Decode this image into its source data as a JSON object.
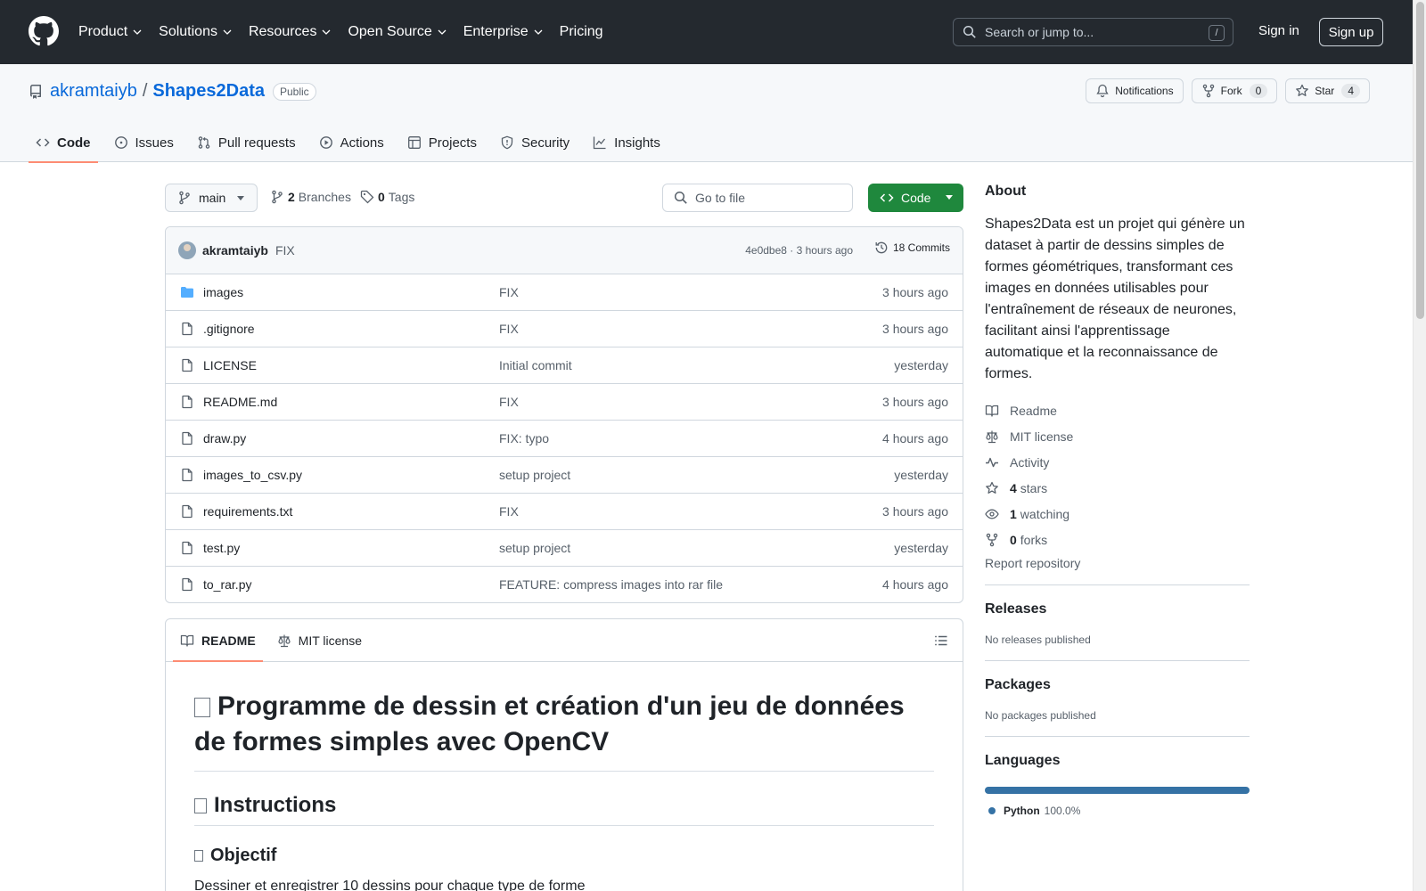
{
  "header": {
    "nav": [
      "Product",
      "Solutions",
      "Resources",
      "Open Source",
      "Enterprise",
      "Pricing"
    ],
    "search_placeholder": "Search or jump to...",
    "search_shortcut": "/",
    "sign_in": "Sign in",
    "sign_up": "Sign up"
  },
  "repo": {
    "owner": "akramtaiyb",
    "separator": "/",
    "name": "Shapes2Data",
    "visibility": "Public",
    "notifications_label": "Notifications",
    "fork_label": "Fork",
    "fork_count": "0",
    "star_label": "Star",
    "star_count": "4",
    "tabs": [
      "Code",
      "Issues",
      "Pull requests",
      "Actions",
      "Projects",
      "Security",
      "Insights"
    ]
  },
  "toolbar": {
    "branch": "main",
    "branches_count": "2",
    "branches_label": "Branches",
    "tags_count": "0",
    "tags_label": "Tags",
    "go_to_file": "Go to file",
    "code_button": "Code"
  },
  "latest_commit": {
    "author": "akramtaiyb",
    "message": "FIX",
    "sha_time": "4e0dbe8 · 3 hours ago",
    "commits_label": "18 Commits"
  },
  "files": [
    {
      "name": "images",
      "type": "folder",
      "message": "FIX",
      "time": "3 hours ago"
    },
    {
      "name": ".gitignore",
      "type": "file",
      "message": "FIX",
      "time": "3 hours ago"
    },
    {
      "name": "LICENSE",
      "type": "file",
      "message": "Initial commit",
      "time": "yesterday"
    },
    {
      "name": "README.md",
      "type": "file",
      "message": "FIX",
      "time": "3 hours ago"
    },
    {
      "name": "draw.py",
      "type": "file",
      "message": "FIX: typo",
      "time": "4 hours ago"
    },
    {
      "name": "images_to_csv.py",
      "type": "file",
      "message": "setup project",
      "time": "yesterday"
    },
    {
      "name": "requirements.txt",
      "type": "file",
      "message": "FIX",
      "time": "3 hours ago"
    },
    {
      "name": "test.py",
      "type": "file",
      "message": "setup project",
      "time": "yesterday"
    },
    {
      "name": "to_rar.py",
      "type": "file",
      "message": "FEATURE: compress images into rar file",
      "time": "4 hours ago"
    }
  ],
  "readme": {
    "tab_readme": "README",
    "tab_license": "MIT license",
    "h1": "Programme de dessin et création d'un jeu de données de formes simples avec OpenCV",
    "h2": "Instructions",
    "h3": "Objectif",
    "p": "Dessiner et enregistrer 10 dessins pour chaque type de forme"
  },
  "about": {
    "title": "About",
    "description": "Shapes2Data est un projet qui génère un dataset à partir de dessins simples de formes géométriques, transformant ces images en données utilisables pour l'entraînement de réseaux de neurones, facilitant ainsi l'apprentissage automatique et la reconnaissance de formes.",
    "readme_link": "Readme",
    "license_link": "MIT license",
    "activity_link": "Activity",
    "stars_count": "4",
    "stars_label": "stars",
    "watching_count": "1",
    "watching_label": "watching",
    "forks_count": "0",
    "forks_label": "forks",
    "report": "Report repository"
  },
  "releases": {
    "title": "Releases",
    "empty": "No releases published"
  },
  "packages": {
    "title": "Packages",
    "empty": "No packages published"
  },
  "languages": {
    "title": "Languages",
    "items": [
      {
        "name": "Python",
        "percent": "100.0%",
        "share": 1.0,
        "color": "#3572A5"
      }
    ]
  },
  "colors": {
    "header_bg": "#24292f",
    "link_blue": "#0969da",
    "code_button_green": "#1f883d",
    "active_tab_underline": "#fd8c73"
  }
}
